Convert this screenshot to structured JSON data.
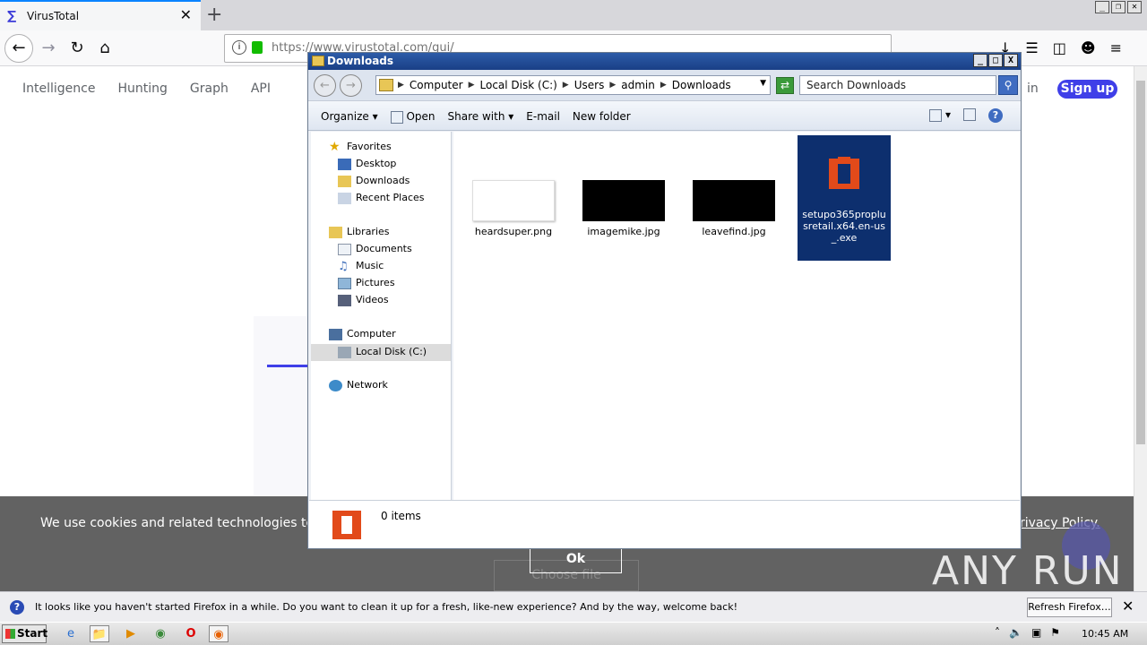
{
  "browser": {
    "tab_title": "VirusTotal",
    "tab_favicon": "virustotal-icon",
    "url": "https://www.virustotal.com/gui/",
    "new_tab": "+"
  },
  "vt": {
    "nav": [
      "Intelligence",
      "Hunting",
      "Graph",
      "API"
    ],
    "signin_fragment": "in",
    "signup": "Sign up",
    "cookie_text": "We use cookies and related technologies to rem",
    "cookie_policy": "rivacy Policy.",
    "ok": "Ok",
    "choose": "Choose file"
  },
  "explorer": {
    "title": "Downloads",
    "breadcrumbs": [
      "Computer",
      "Local Disk (C:)",
      "Users",
      "admin",
      "Downloads"
    ],
    "search_placeholder": "Search Downloads",
    "commands": [
      "Organize",
      "Open",
      "Share with",
      "E-mail",
      "New folder"
    ],
    "nav": {
      "favorites": "Favorites",
      "desktop": "Desktop",
      "downloads": "Downloads",
      "recent": "Recent Places",
      "libraries": "Libraries",
      "documents": "Documents",
      "music": "Music",
      "pictures": "Pictures",
      "videos": "Videos",
      "computer": "Computer",
      "localdisk": "Local Disk (C:)",
      "network": "Network"
    },
    "files": [
      {
        "name": "heardsuper.png"
      },
      {
        "name": "imagemike.jpg"
      },
      {
        "name": "leavefind.jpg"
      },
      {
        "name": "setupo365proplusretail.x64.en-us_.exe"
      }
    ],
    "status": "0 items"
  },
  "notification": {
    "text": "It looks like you haven't started Firefox in a while. Do you want to clean it up for a fresh, like-new experience? And by the way, welcome back!",
    "button": "Refresh Firefox…"
  },
  "taskbar": {
    "start": "Start",
    "clock": "10:45 AM"
  },
  "watermark": "ANY RUN",
  "colors": {
    "accent": "#3f3fe8",
    "selection": "#0d2f6e",
    "office": "#e24a1a"
  }
}
